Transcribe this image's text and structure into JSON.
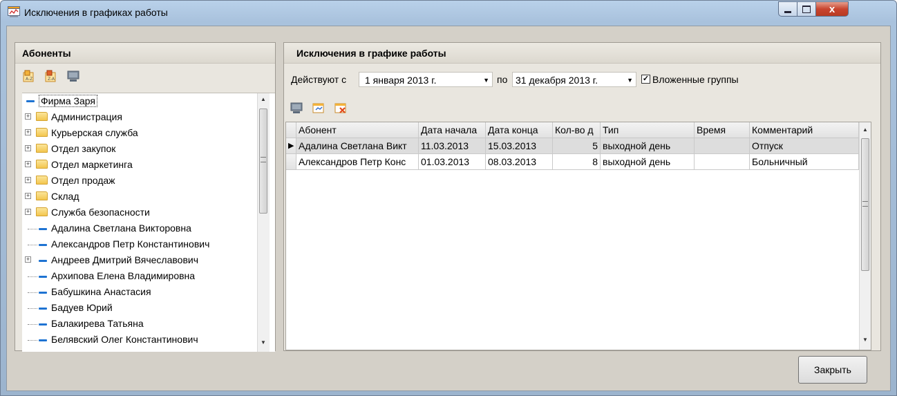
{
  "window": {
    "title": "Исключения в графиках работы",
    "close_glyph": "x"
  },
  "left": {
    "header": "Абоненты",
    "toolbar": [
      "sort-az-icon",
      "sort-za-icon",
      "screen-icon"
    ],
    "tree": [
      {
        "label": "Фирма Заря",
        "type": "root"
      },
      {
        "label": "Администрация",
        "type": "folder"
      },
      {
        "label": "Курьерская служба",
        "type": "folder"
      },
      {
        "label": "Отдел закупок",
        "type": "folder"
      },
      {
        "label": "Отдел маркетинга",
        "type": "folder"
      },
      {
        "label": "Отдел продаж",
        "type": "folder"
      },
      {
        "label": "Склад",
        "type": "folder"
      },
      {
        "label": "Служба безопасности",
        "type": "folder"
      },
      {
        "label": "Адалина Светлана Викторовна",
        "type": "person"
      },
      {
        "label": "Александров Петр Константинович",
        "type": "person"
      },
      {
        "label": "Андреев Дмитрий Вячеславович",
        "type": "person-expandable"
      },
      {
        "label": "Архипова Елена Владимировна",
        "type": "person"
      },
      {
        "label": "Бабушкина Анастасия",
        "type": "person"
      },
      {
        "label": "Бадуев Юрий",
        "type": "person"
      },
      {
        "label": "Балакирева Татьяна",
        "type": "person"
      },
      {
        "label": "Белявский Олег Константинович",
        "type": "person"
      }
    ]
  },
  "right": {
    "header": "Исключения в графике работы",
    "filter": {
      "from_label": "Действуют с",
      "from_value": "1   января   2013 г.",
      "to_label": "по",
      "to_value": "31 декабря 2013 г.",
      "nested_label": "Вложенные группы",
      "nested_checked": true
    },
    "grid": {
      "columns": [
        "Абонент",
        "Дата начала",
        "Дата конца",
        "Кол-во д",
        "Тип",
        "Время",
        "Комментарий"
      ],
      "rows": [
        [
          "Адалина Светлана Викт",
          "11.03.2013",
          "15.03.2013",
          "5",
          "выходной день",
          "",
          "Отпуск"
        ],
        [
          "Александров Петр Конс",
          "01.03.2013",
          "08.03.2013",
          "8",
          "выходной день",
          "",
          "Больничный"
        ]
      ],
      "selected_row": 0
    }
  },
  "footer": {
    "close_label": "Закрыть"
  }
}
